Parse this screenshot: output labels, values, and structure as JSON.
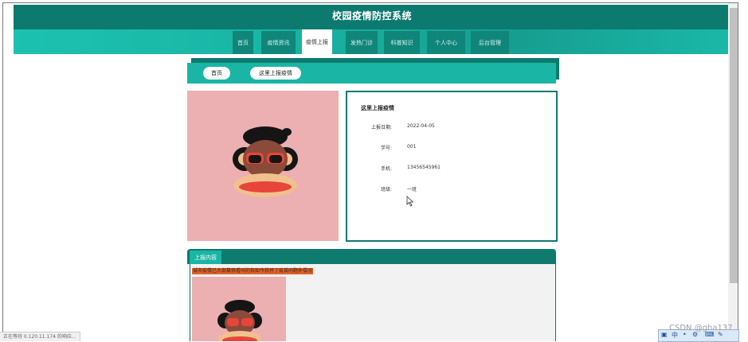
{
  "header": {
    "title": "校园疫情防控系统"
  },
  "nav": {
    "items": [
      {
        "label": "首页",
        "active": false
      },
      {
        "label": "疫情资讯",
        "active": false
      },
      {
        "label": "疫情上报",
        "active": true
      },
      {
        "label": "发热门诊",
        "active": false
      },
      {
        "label": "科普知识",
        "active": false
      },
      {
        "label": "个人中心",
        "active": false
      },
      {
        "label": "后台管理",
        "active": false
      }
    ]
  },
  "breadcrumb": {
    "home": "首页",
    "current": "这里上报疫情"
  },
  "detail": {
    "title": "这里上报疫情",
    "fields": [
      {
        "label": "上报日期:",
        "value": "2022-04-05"
      },
      {
        "label": "学号:",
        "value": "001"
      },
      {
        "label": "手机:",
        "value": "13456545961"
      },
      {
        "label": "班级:",
        "value": "一班"
      }
    ]
  },
  "content": {
    "tab_label": "上报内容",
    "text": "城市疫情已大部篡修看叫的但如今获并了疫苗问题补偿况"
  },
  "status_bar": {
    "url": "正在等待 0.120.11.174 的响应..."
  },
  "watermark": {
    "text": "CSDN @gha137"
  },
  "colors": {
    "primary_dark": "#0c7a6e",
    "primary": "#1ab5a5",
    "photo_bg": "#ecafb2",
    "highlight": "#e0622a"
  }
}
